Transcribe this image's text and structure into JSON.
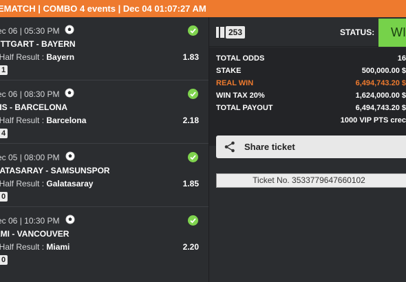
{
  "header": {
    "title": "EMATCH | COMBO 4 events | Dec 04 01:07:27 AM"
  },
  "events": [
    {
      "datetime": "ec 06 | 05:30 PM",
      "teams": "UTTGART - BAYERN",
      "market": "t Half Result : ",
      "selection": "Bayern",
      "odds": "1.83",
      "score": "1"
    },
    {
      "datetime": "ec 06 | 08:30 PM",
      "teams": "TIS - BARCELONA",
      "market": "t Half Result : ",
      "selection": "Barcelona",
      "odds": "2.18",
      "score": "4"
    },
    {
      "datetime": "ec 05 | 08:00 PM",
      "teams": "LATASARAY - SAMSUNSPOR",
      "market": "t Half Result : ",
      "selection": "Galatasaray",
      "odds": "1.85",
      "score": "0"
    },
    {
      "datetime": "ec 06 | 10:30 PM",
      "teams": "AMI - VANCOUVER",
      "market": "t Half Result : ",
      "selection": "Miami",
      "odds": "2.20",
      "score": "0"
    }
  ],
  "ticket": {
    "badge": "253",
    "status_label": "STATUS:",
    "status_value": "WI",
    "summary": {
      "total_odds_label": "TOTAL ODDS",
      "total_odds_value": "16",
      "stake_label": "STAKE",
      "stake_value": "500,000.00 $",
      "real_win_label": "REAL WIN",
      "real_win_value": "6,494,743.20 $",
      "tax_label": "WIN TAX 20%",
      "tax_value": "1,624,000.00 $",
      "payout_label": "TOTAL PAYOUT",
      "payout_value": "6,494,743.20 $",
      "vip_text": "1000 VIP PTS crec"
    },
    "share_label": "Share ticket",
    "ticket_number": "Ticket No. 3533779647660102"
  },
  "colors": {
    "accent": "#ee7a2e",
    "win": "#76d24a",
    "check": "#7fd34e"
  }
}
